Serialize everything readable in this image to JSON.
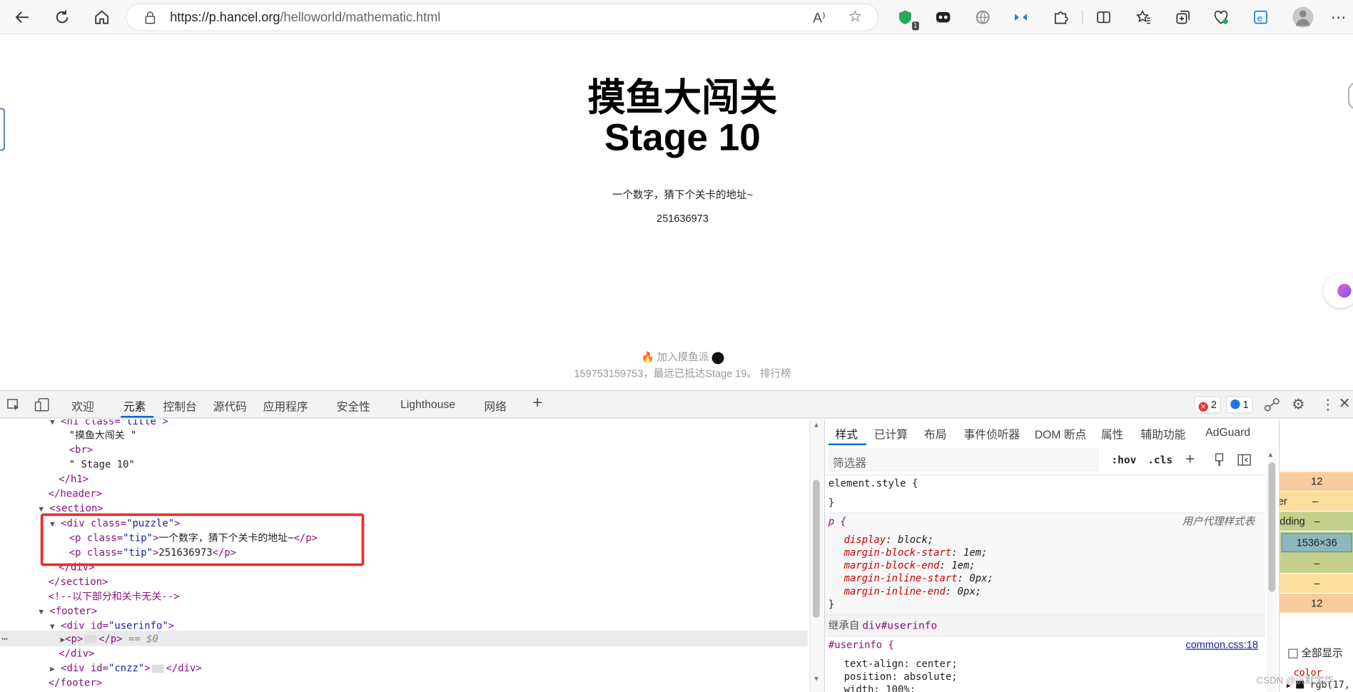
{
  "browser": {
    "url_prefix": "https://p.hancel.org",
    "url_path": "/helloworld/mathematic.html",
    "ext_badge_1": "1"
  },
  "page": {
    "title_line1": "摸鱼大闯关",
    "title_line2": "Stage 10",
    "tip1": "一个数字，猜下个关卡的地址~",
    "tip2": "251636973",
    "footer_join": "加入摸鱼派",
    "footer_stats": "159753159753，最远已抵达Stage 19。 排行榜"
  },
  "devtools": {
    "tabs": [
      "欢迎",
      "元素",
      "控制台",
      "源代码",
      "应用程序",
      "安全性",
      "Lighthouse",
      "网络"
    ],
    "errors": "2",
    "messages": "1"
  },
  "dom_lines": {
    "l0_tag": "<h1 class=",
    "l0_val": "\"title\"",
    "l0_end": ">",
    "l1": "\"摸鱼大闯关 \"",
    "l2": "<br>",
    "l3": "\" Stage 10\"",
    "l4": "</h1>",
    "l5": "</header>",
    "l6": "<section>",
    "l7_tag": "<div class=",
    "l7_val": "\"puzzle\"",
    "l7_end": ">",
    "l8_tag": "<p class=",
    "l8_val": "\"tip\"",
    "l8_mid": ">",
    "l8_text": "一个数字，猜下个关卡的地址~",
    "l8_end": "</p>",
    "l9_tag": "<p class=",
    "l9_val": "\"tip\"",
    "l9_mid": ">",
    "l9_text": "251636973",
    "l9_end": "</p>",
    "l10": "</div>",
    "l11": "</section>",
    "l12": "<!--以下部分和关卡无关-->",
    "l13": "<footer>",
    "l14_tag": "<div id=",
    "l14_val": "\"userinfo\"",
    "l14_end": ">",
    "l15_tag": "<p>",
    "l15_end": "</p>",
    "l15_sel": "== $0",
    "l16": "</div>",
    "l17_tag": "<div id=",
    "l17_val": "\"cnzz\"",
    "l17_mid": ">",
    "l17_end": "</div>",
    "l18": "</footer>"
  },
  "styles": {
    "tabs": [
      "样式",
      "已计算",
      "布局",
      "事件侦听器",
      "DOM 断点",
      "属性",
      "辅助功能",
      "AdGuard"
    ],
    "filter_placeholder": "筛选器",
    "hov": ":hov",
    "cls": ".cls",
    "element_style": "element.style {",
    "close_brace": "}",
    "p_selector": "p {",
    "ua_label": "用户代理样式表",
    "p_props": [
      [
        "display",
        "block;"
      ],
      [
        "margin-block-start",
        "1em;"
      ],
      [
        "margin-block-end",
        "1em;"
      ],
      [
        "margin-inline-start",
        "0px;"
      ],
      [
        "margin-inline-end",
        "0px;"
      ]
    ],
    "inherited_prefix": "继承自 ",
    "inherited_from": "div#userinfo",
    "userinfo_selector": "#userinfo {",
    "userinfo_source": "common.css:18",
    "userinfo_props": [
      [
        "text-align",
        "center;"
      ],
      [
        "position",
        "absolute;"
      ],
      [
        "width",
        "100%;"
      ]
    ]
  },
  "boxmodel": {
    "margin_top": "12",
    "border": "–",
    "padding_label": "dding",
    "content": "1536×36",
    "dash": "–",
    "margin_bottom": "12",
    "show_all": "全部显示",
    "color_label": "color",
    "color_value": "rgb(17,",
    "watermark": "CSDN @沉默宝华"
  }
}
